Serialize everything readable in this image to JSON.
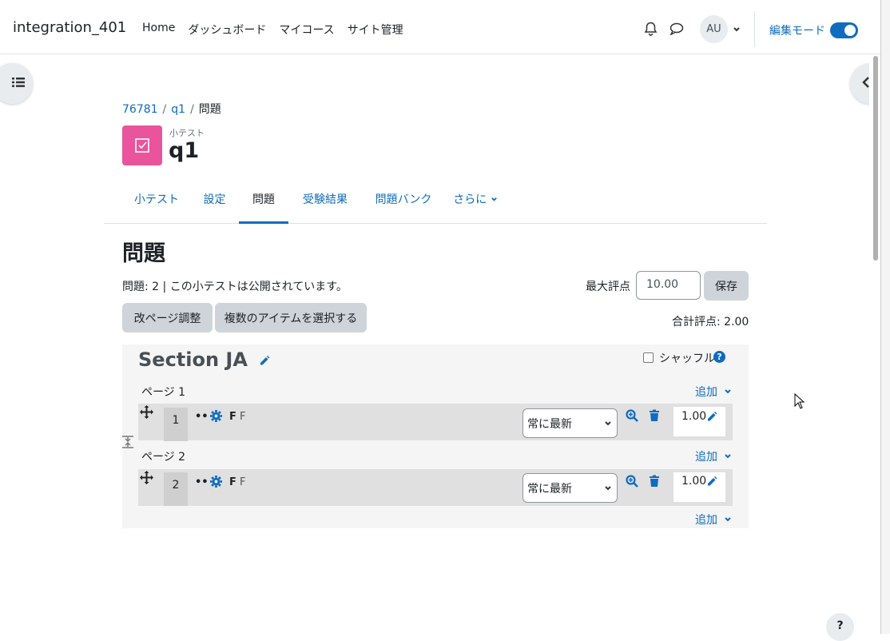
{
  "navbar": {
    "site_name": "integration_401",
    "links": [
      "Home",
      "ダッシュボード",
      "マイコース",
      "サイト管理"
    ],
    "avatar_initials": "AU",
    "edit_mode_label": "編集モード",
    "edit_mode_on": true
  },
  "breadcrumb": [
    "76781",
    "q1",
    "問題"
  ],
  "header": {
    "activity_type": "小テスト",
    "title": "q1",
    "icon_color": "#e9549c"
  },
  "tabs": [
    "小テスト",
    "設定",
    "問題",
    "受験結果",
    "問題バンク",
    "さらに"
  ],
  "active_tab": "問題",
  "main": {
    "heading": "問題",
    "status": "問題: 2 | この小テストは公開されています。",
    "max_grade_label": "最大評点",
    "max_grade_value": "10.00",
    "save_label": "保存",
    "repaginate_label": "改ページ調整",
    "select_multiple_label": "複数のアイテムを選択する",
    "total_marks": "合計評点: 2.00"
  },
  "section": {
    "title": "Section JA",
    "shuffle_label": "シャッフル",
    "shuffle_checked": false,
    "add_label": "追加",
    "pages": [
      {
        "label": "ページ 1",
        "slot": {
          "number": "1",
          "name": "F",
          "text": "F",
          "version": "常に最新",
          "mark": "1.00"
        }
      },
      {
        "label": "ページ 2",
        "slot": {
          "number": "2",
          "name": "F",
          "text": "F",
          "version": "常に最新",
          "mark": "1.00"
        }
      }
    ]
  },
  "help_label": "?",
  "colors": {
    "link": "#0f6cbf",
    "button_gray": "#ced4da",
    "section_bg": "#f5f5f5",
    "slot_bg": "#e0e0e0"
  }
}
